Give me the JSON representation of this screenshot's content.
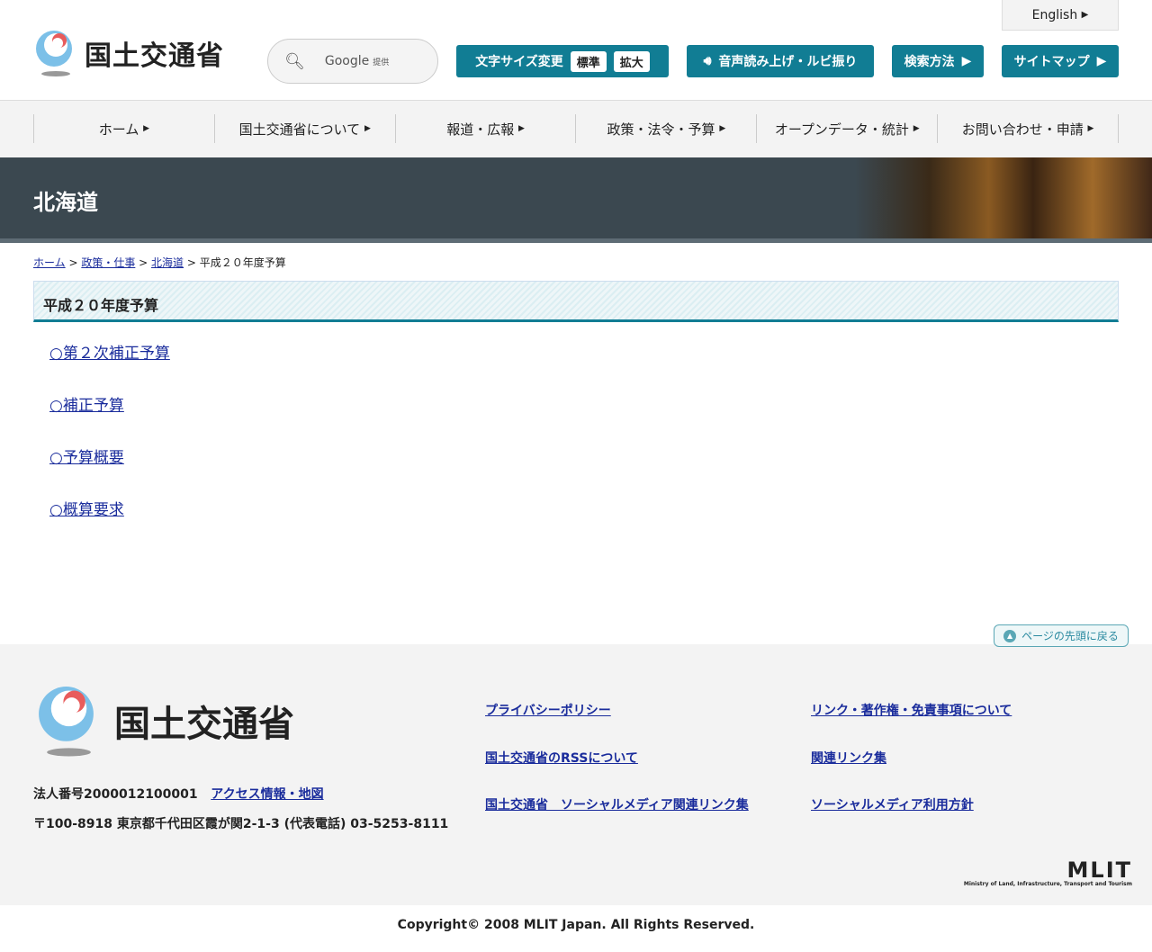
{
  "header": {
    "logo_text": "国土交通省",
    "search_brand": "Google",
    "search_provided": "提供",
    "font_size_label": "文字サイズ変更",
    "font_standard": "標準",
    "font_large": "拡大",
    "speech": "音声読み上げ・ルビ振り",
    "search_method": "検索方法",
    "sitemap": "サイトマップ",
    "english": "English"
  },
  "nav": [
    "ホーム",
    "国土交通省について",
    "報道・広報",
    "政策・法令・予算",
    "オープンデータ・統計",
    "お問い合わせ・申請"
  ],
  "banner": {
    "title": "北海道"
  },
  "breadcrumb": {
    "home": "ホーム",
    "policy": "政策・仕事",
    "hokkaido": "北海道",
    "current": "平成２０年度予算"
  },
  "page": {
    "title": "平成２０年度予算",
    "links": [
      "○第２次補正予算",
      "○補正予算",
      "○予算概要",
      "○概算要求"
    ]
  },
  "totop": "ページの先頭に戻る",
  "footer": {
    "logo_text": "国土交通省",
    "corp_no": "法人番号2000012100001",
    "access": "アクセス情報・地図",
    "address": "〒100-8918 東京都千代田区霞が関2-1-3 (代表電話) 03-5253-8111",
    "links": [
      "プライバシーポリシー",
      "リンク・著作権・免責事項について",
      "国土交通省のRSSについて",
      "関連リンク集",
      "国土交通省　ソーシャルメディア関連リンク集",
      "ソーシャルメディア利用方針"
    ],
    "mlit": "MLIT",
    "mlit_sub": "Ministry of Land, Infrastructure, Transport and Tourism",
    "copyright": "Copyright© 2008 MLIT Japan. All Rights Reserved."
  }
}
